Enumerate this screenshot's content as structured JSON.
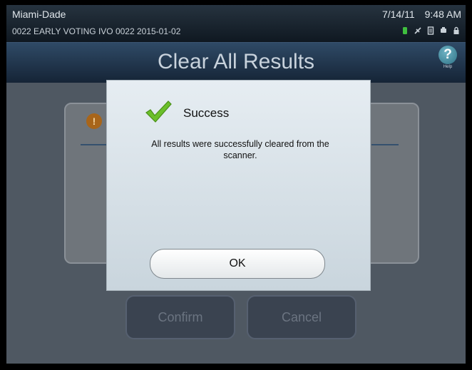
{
  "status": {
    "location": "Miami-Dade",
    "precinct_line": "0022 EARLY VOTING IVO 0022   2015-01-02",
    "date": "7/14/11",
    "time": "9:48 AM",
    "icons": [
      "battery-icon",
      "network-icon",
      "document-icon",
      "printer-icon",
      "lock-icon"
    ]
  },
  "header": {
    "title": "Clear All Results",
    "help_label": "Help"
  },
  "background_buttons": {
    "confirm": "Confirm",
    "cancel": "Cancel"
  },
  "dialog": {
    "title": "Success",
    "message": "All results were successfully cleared from the scanner.",
    "ok_label": "OK"
  }
}
